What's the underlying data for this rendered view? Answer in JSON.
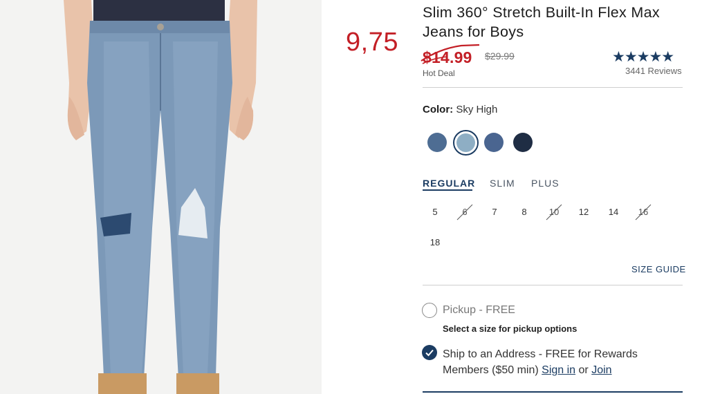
{
  "note": {
    "handwritten_price": "9,75"
  },
  "product": {
    "title": "Slim 360° Stretch Built-In Flex Max Jeans for Boys",
    "sale_price": "$14.99",
    "original_price": "$29.99",
    "deal_label": "Hot Deal",
    "rating_stars": "★★★★★",
    "reviews": "3441 Reviews"
  },
  "color": {
    "label": "Color:",
    "value": "Sky High",
    "swatches": [
      {
        "name": "medium-wash",
        "hex": "#4e6d93"
      },
      {
        "name": "sky-high",
        "hex": "#8eaec4",
        "selected": true
      },
      {
        "name": "mid-blue",
        "hex": "#4a6590"
      },
      {
        "name": "dark-rinse",
        "hex": "#1f2d44"
      }
    ]
  },
  "fits": [
    {
      "label": "REGULAR",
      "active": true
    },
    {
      "label": "SLIM",
      "active": false
    },
    {
      "label": "PLUS",
      "active": false
    }
  ],
  "sizes": [
    {
      "label": "5",
      "available": true
    },
    {
      "label": "6",
      "available": false
    },
    {
      "label": "7",
      "available": true
    },
    {
      "label": "8",
      "available": true
    },
    {
      "label": "10",
      "available": false
    },
    {
      "label": "12",
      "available": true
    },
    {
      "label": "14",
      "available": true
    },
    {
      "label": "16",
      "available": false
    },
    {
      "label": "18",
      "available": true
    }
  ],
  "size_guide": "SIZE GUIDE",
  "fulfillment": {
    "pickup_label": "Pickup - FREE",
    "pickup_note": "Select a size for pickup options",
    "ship_text": "Ship to an Address - FREE for Rewards Members ($50 min)",
    "sign_in": "Sign in",
    "or": "or",
    "join": "Join"
  },
  "colors": {
    "brand_navy": "#1b3c62",
    "sale_red": "#c31f26"
  }
}
